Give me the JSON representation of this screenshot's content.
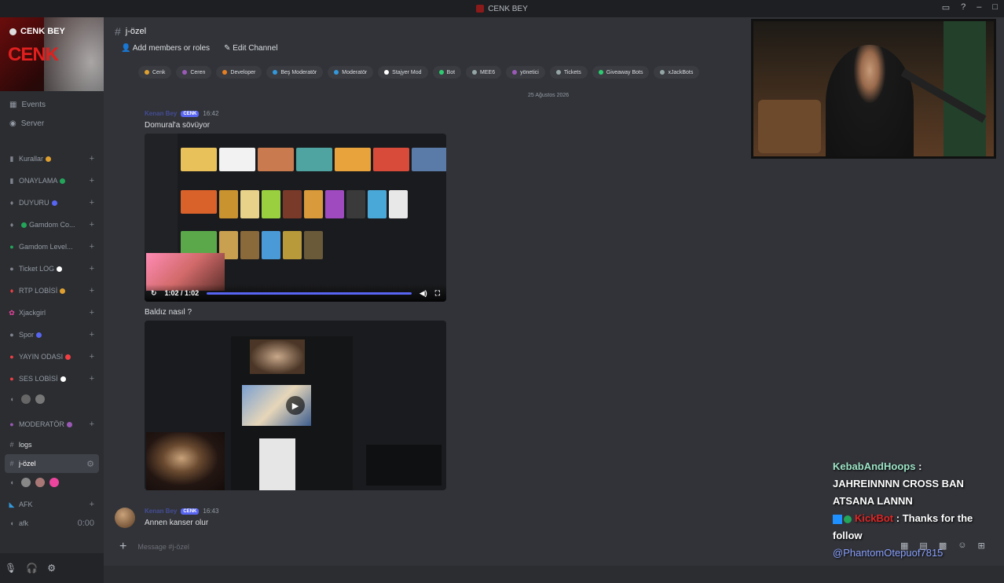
{
  "window": {
    "title": "CENK BEY",
    "controls": [
      "▭",
      "?",
      "–",
      "□"
    ]
  },
  "server": {
    "name": "CENK BEY",
    "brand": "CENK"
  },
  "sidebar": {
    "links": [
      "Events",
      "Server"
    ],
    "channels": [
      {
        "icon": "▮",
        "label": "Kurallar",
        "pill": "#e0a030"
      },
      {
        "icon": "▮",
        "label": "ONAYLAMA",
        "pill": "#23a55a"
      },
      {
        "icon": "♦",
        "label": "DUYURU",
        "pill": "#5865f2"
      },
      {
        "icon": "♦",
        "label": "Gamdom Co...",
        "pill": "#23a55a"
      },
      {
        "icon": "●",
        "label": "Gamdom Level...",
        "pill": ""
      },
      {
        "icon": "●",
        "label": "Ticket LOG",
        "pill": "#ffffff"
      },
      {
        "icon": "♦",
        "label": "RTP LOBİSİ",
        "pill": "#e0a030"
      },
      {
        "icon": "✿",
        "label": "Xjackgirl",
        "pill": ""
      },
      {
        "icon": "●",
        "label": "Spor",
        "pill": "#5865f2"
      },
      {
        "icon": "●",
        "label": "YAYIN ODASI",
        "pill": "#f23f43"
      },
      {
        "icon": "●",
        "label": "SES LOBİSİ",
        "pill": "#ffffff"
      }
    ],
    "lower": [
      {
        "icon": "●",
        "label": "MODERATÖR"
      },
      {
        "icon": "#",
        "label": "logs"
      },
      {
        "icon": "#",
        "label": "j-özel"
      },
      {
        "icon": "◣",
        "label": "AFK"
      },
      {
        "icon": "◖",
        "label": "afk",
        "time": "0:00"
      }
    ]
  },
  "userbar": {
    "icons": [
      "mic-icon",
      "headphones-icon",
      "gear-icon"
    ]
  },
  "channel": {
    "name": "j-özel",
    "add_members": "Add members or roles",
    "edit_channel": "Edit Channel"
  },
  "roles": [
    {
      "label": "Cenk",
      "color": "#e0a030"
    },
    {
      "label": "Ceren",
      "color": "#9b59b6"
    },
    {
      "label": "Developer",
      "color": "#e67e22"
    },
    {
      "label": "Beş Moderatör",
      "color": "#3498db"
    },
    {
      "label": "Moderatör",
      "color": "#3498db"
    },
    {
      "label": "Stajyer Mod",
      "color": "#ffffff"
    },
    {
      "label": "Bot",
      "color": "#2ecc71"
    },
    {
      "label": "MEE6",
      "color": "#95a5a6"
    },
    {
      "label": "yönetici",
      "color": "#9b59b6"
    },
    {
      "label": "Tickets",
      "color": "#95a5a6"
    },
    {
      "label": "Giveaway Bots",
      "color": "#2ecc71"
    },
    {
      "label": "xJackBots",
      "color": "#95a5a6"
    }
  ],
  "messages": {
    "date": "25 Ağustos 2026",
    "author1": "Kenan Bey",
    "tag": "CENK",
    "time1": "16:42",
    "text1": "Domural'a sövüyor",
    "video_time": "1:02 / 1:02",
    "text2": "Baldız nasıl ?",
    "author2": "Kenan Bey",
    "time2": "16:43",
    "text3": "Annen kanser olur"
  },
  "composer": {
    "placeholder": "Message #j-özel"
  },
  "stream_chat": {
    "user1": "KebabAndHoops",
    "msg1": "JAHREINNNN CROSS BAN ATSANA LANNN",
    "user2": "KickBot",
    "msg2": "Thanks for the follow",
    "mention": "@PhantomOtepuof7815"
  },
  "colors": {
    "accent": "#5865f2",
    "brand": "#e0201e"
  }
}
